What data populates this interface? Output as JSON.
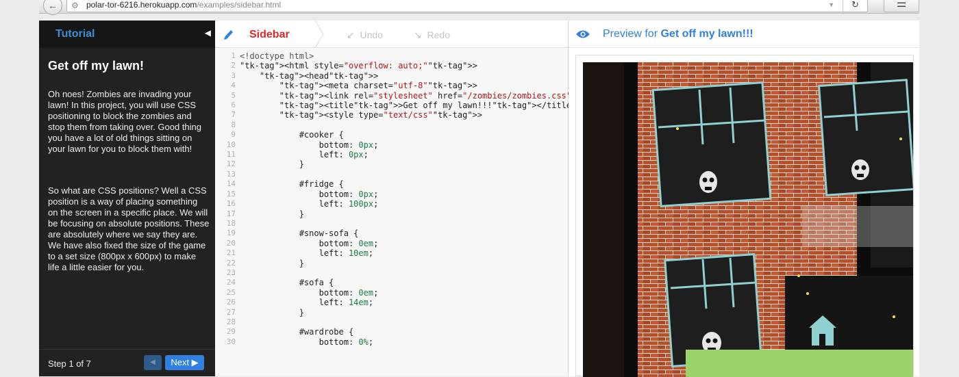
{
  "browser": {
    "back_icon": "back-arrow-icon",
    "url_host": "polar-tor-6216.herokuapp.com",
    "url_path": "/examples/sidebar.html",
    "reload_icon": "reload-icon",
    "menu_icon": "hamburger-menu-icon"
  },
  "tutorial": {
    "title": "Tutorial",
    "collapse_glyph": "◀",
    "heading": "Get off my lawn!",
    "paragraphs": [
      "Oh noes! Zombies are invading your lawn! In this project, you will use CSS positioning to block the zombies and stop them from taking over. Good thing you have a lot of old things sitting on your lawn for you to block them with!",
      "So what are CSS positions? Well a CSS position is a way of placing something on the screen in a specific place. We will be focusing on absolute positions. These are absolutely where we say they are. We have also fixed the size of the game to a set size (800px x 600px) to make life a little easier for you."
    ],
    "step_label": "Step 1 of 7",
    "prev_glyph": "◀",
    "next_label": "Next ▶"
  },
  "editor": {
    "tab_label": "Sidebar",
    "undo_label": "Undo",
    "redo_label": "Redo",
    "line_numbers": [
      "1",
      "2",
      "3",
      "4",
      "5",
      "6",
      "7",
      "8",
      "9",
      "10",
      "11",
      "12",
      "13",
      "14",
      "15",
      "16",
      "17",
      "18",
      "19",
      "20",
      "21",
      "22",
      "23",
      "24",
      "25",
      "26",
      "27",
      "28",
      "29",
      "30"
    ],
    "code_lines": [
      "<!doctype html>",
      "<html style=\"overflow: auto;\">",
      "    <head>",
      "        <meta charset=\"utf-8\">",
      "        <link rel=\"stylesheet\" href=\"/zombies/zombies.css\">",
      "        <title>Get off my lawn!!!</title>",
      "        <style type=\"text/css\">",
      "",
      "            #cooker {",
      "                bottom: 0px;",
      "                left: 0px;",
      "            }",
      "",
      "            #fridge {",
      "                bottom: 0px;",
      "                left: 100px;",
      "            }",
      "",
      "            #snow-sofa {",
      "                bottom: 0em;",
      "                left: 10em;",
      "            }",
      "",
      "            #sofa {",
      "                bottom: 0em;",
      "                left: 14em;",
      "            }",
      "",
      "            #wardrobe {",
      "                bottom: 0%;"
    ]
  },
  "preview": {
    "label": "Preview",
    "for_word": "for",
    "page_title": "Get off my lawn!!!"
  },
  "colors": {
    "accent_blue": "#2f80e0",
    "sidebar_red": "#e0282b",
    "tutorial_bg": "#222222"
  }
}
